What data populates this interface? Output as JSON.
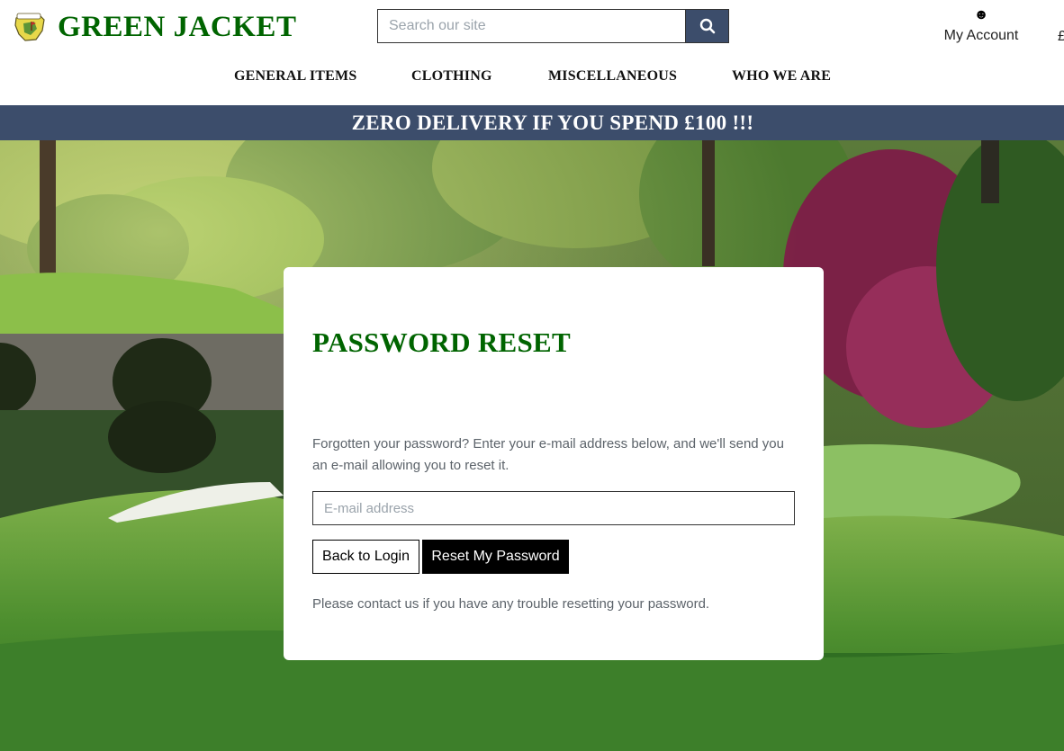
{
  "brand": {
    "name": "GREEN JACKET"
  },
  "search": {
    "placeholder": "Search our site"
  },
  "account": {
    "label": "My Account",
    "icon": "smiley-icon"
  },
  "basket": {
    "label": "£"
  },
  "nav": {
    "items": [
      {
        "label": "GENERAL ITEMS"
      },
      {
        "label": "CLOTHING"
      },
      {
        "label": "MISCELLANEOUS"
      },
      {
        "label": "WHO WE ARE"
      }
    ]
  },
  "banner": {
    "text": "ZERO DELIVERY IF YOU SPEND £100 !!!"
  },
  "reset": {
    "title": "PASSWORD RESET",
    "instructions": "Forgotten your password? Enter your e-mail address below, and we'll send you an e-mail allowing you to reset it.",
    "email_placeholder": "E-mail address",
    "back_label": "Back to Login",
    "submit_label": "Reset My Password",
    "note": "Please contact us if you have any trouble resetting your password."
  },
  "colors": {
    "brand_green": "#006400",
    "navy": "#3c4d6b"
  }
}
